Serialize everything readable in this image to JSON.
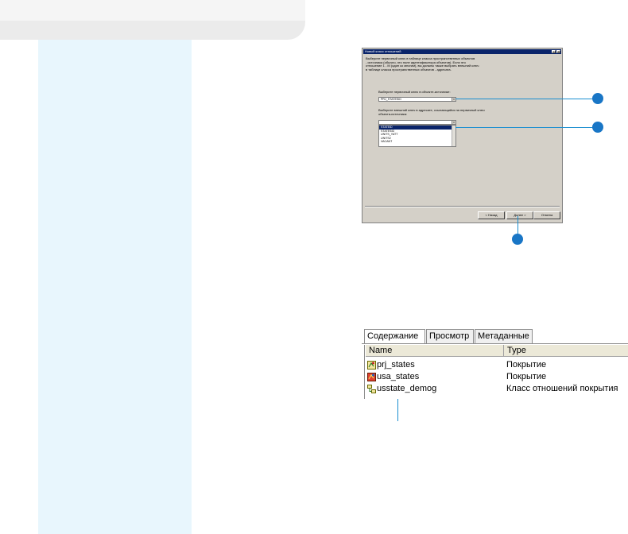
{
  "dialog": {
    "title": "Новый класс отношений",
    "help_btn": "?",
    "close_btn": "✕",
    "intro": "Выберите первичный ключ в таблице класса пространственных объектов\n- источника (обычно, это поле идентификатора объектов). Если это\nотношение 1 - М (один ко многим), вы должны также выбрать внешний ключ\nв таблице класса пространственных объектов - адресата.",
    "primary_key_label": "Выберите первичный ключ в объекте-источнике:",
    "primary_key_value": "PRJ_STATESID",
    "foreign_key_label": "Выберите внешний ключ в адресате, ссылающийся на первичный ключ\nобъекта-источника:",
    "foreign_key_value": "",
    "list_items": [
      "STATEID",
      "STATESID",
      "UNITS_YATT",
      "UNITS2",
      "VACANT"
    ],
    "selected_index": 0,
    "buttons": {
      "back": "< Назад",
      "next": "Далее >",
      "cancel": "Отмена"
    }
  },
  "catalog": {
    "tabs": [
      "Содержание",
      "Просмотр",
      "Метаданные"
    ],
    "active_tab": 0,
    "columns": {
      "name": "Name",
      "type": "Type"
    },
    "rows": [
      {
        "name": "prj_states",
        "type": "Покрытие",
        "icon": "coverage-icon"
      },
      {
        "name": "usa_states",
        "type": "Покрытие",
        "icon": "coverage-icon"
      },
      {
        "name": "usstate_demog",
        "type": "Класс отношений покрытия",
        "icon": "relationship-class-icon"
      }
    ]
  },
  "colors": {
    "callout": "#1976c6",
    "side_panel": "#e8f6fd",
    "dialog_face": "#d4d0c8",
    "titlebar": "#0a246a"
  }
}
